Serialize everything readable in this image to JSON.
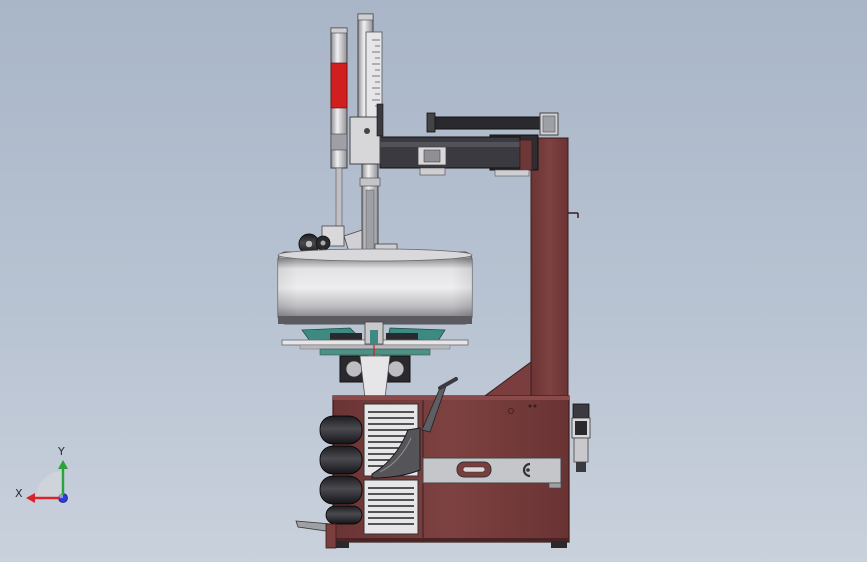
{
  "viewport": {
    "background_top": "#a9b6c8",
    "background_bottom": "#c9d1dc"
  },
  "triad": {
    "x_label": "X",
    "y_label": "Y",
    "x_color": "#d7262b",
    "y_color": "#2aa33a",
    "z_color": "#2d3bd8"
  },
  "colors": {
    "body": "#7a3e3e",
    "body_dark": "#5a2a2a",
    "steel": "#c9c9cc",
    "turntable_teal": "#3d8a82",
    "gauge_red": "#d11f1f"
  }
}
